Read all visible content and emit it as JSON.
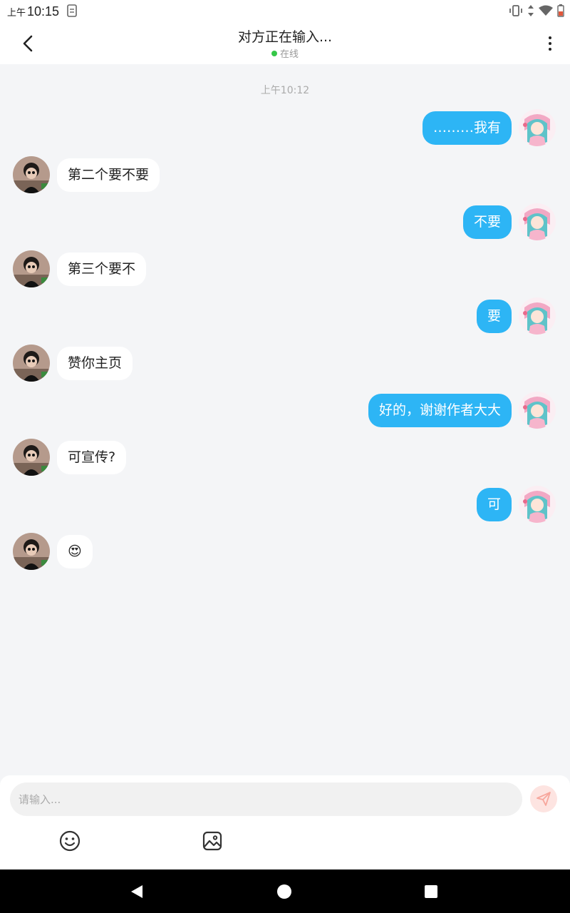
{
  "status_bar": {
    "ampm": "上午",
    "time": "10:15"
  },
  "header": {
    "title": "对方正在输入...",
    "presence_text": "在线",
    "presence_color": "#35c748"
  },
  "chat": {
    "timestamp": "上午10:12",
    "messages": [
      {
        "side": "right",
        "text": "………我有"
      },
      {
        "side": "left",
        "text": "第二个要不要"
      },
      {
        "side": "right",
        "text": "不要"
      },
      {
        "side": "left",
        "text": "第三个要不"
      },
      {
        "side": "right",
        "text": "要"
      },
      {
        "side": "left",
        "text": "赞你主页"
      },
      {
        "side": "right",
        "text": "好的，谢谢作者大大"
      },
      {
        "side": "left",
        "text": "可宣传?"
      },
      {
        "side": "right",
        "text": "可"
      },
      {
        "side": "left",
        "text": "😍"
      }
    ]
  },
  "composer": {
    "placeholder": "请输入...",
    "send_icon": "send-icon",
    "tools": [
      "emoji-icon",
      "image-icon"
    ]
  },
  "colors": {
    "own_bubble": "#2db5f5",
    "peer_bubble": "#ffffff",
    "background": "#f4f5f7"
  }
}
